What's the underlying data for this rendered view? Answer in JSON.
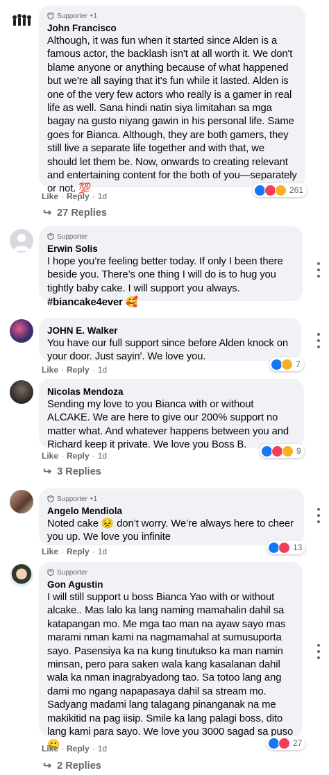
{
  "comments": [
    {
      "badge": "Supporter +1",
      "author": "John Francisco",
      "text": "Although, it was fun when it started since Alden is a famous actor, the backlash isn't at all worth it. We don't blame anyone or anything because of what happened but we're all saying that it's fun while it lasted. Alden is one of the very few actors who really is a gamer in real life as well. Sana hindi natin siya limitahan sa mga bagay na gusto niyang gawin in his personal life. Same goes for Bianca. Although, they are both gamers, they still live a separate life together and with that, we should let them be. Now, onwards to creating relevant and entertaining content for the both of you—separately or not. 💯",
      "like": "Like",
      "reply": "Reply",
      "time": "1d",
      "reaction_count": "261",
      "replies": "27 Replies"
    },
    {
      "badge": "Supporter",
      "author": "Erwin Solis",
      "text": "I hope you’re feeling better today. If only I been there beside you. There’s one thing I will do is to hug you tightly baby cake. I will support you always.",
      "hashtag": "#biancake4ever 🥰"
    },
    {
      "author": "JOHN E. Walker",
      "text": "You have our full support since before Alden knock on your door. Just sayin'. We love you.",
      "like": "Like",
      "reply": "Reply",
      "time": "1d",
      "reaction_count": "7"
    },
    {
      "author": "Nicolas Mendoza",
      "text": "Sending my love to you Bianca with or without ALCAKE. We are here to give our 200% support no matter what. And whatever happens between you and Richard keep it private. We love you Boss B.",
      "like": "Like",
      "reply": "Reply",
      "time": "1d",
      "reaction_count": "9",
      "replies": "3 Replies"
    },
    {
      "badge": "Supporter +1",
      "author": "Angelo Mendiola",
      "text": "Noted cake 😣 don’t worry. We’re always here to cheer you up. We love you infinite",
      "like": "Like",
      "reply": "Reply",
      "time": "1d",
      "reaction_count": "13"
    },
    {
      "badge": "Supporter",
      "author": "Gon Agustin",
      "text": "I will still support u boss Bianca Yao with or without alcake.. Mas lalo ka lang naming mamahalin dahil sa katapangan mo. Me mga tao man na ayaw sayo mas marami nman kami na nagmamahal at sumusuporta sayo. Pasensiya ka na kung tinutukso ka man namin minsan, pero para saken wala kang kasalanan dahil wala ka nman inagrabyadong tao. Sa totoo lang ang dami mo ngang napapasaya dahil sa stream mo. Sadyang madami lang talagang pinanganak na me makikitid na pag iisip. Smile ka lang palagi boss, dito lang kami para sayo. We love you 3000 sagad sa puso 🙂",
      "like": "Like",
      "reply": "Reply",
      "time": "1d",
      "reaction_count": "27",
      "replies": "2 Replies"
    }
  ]
}
